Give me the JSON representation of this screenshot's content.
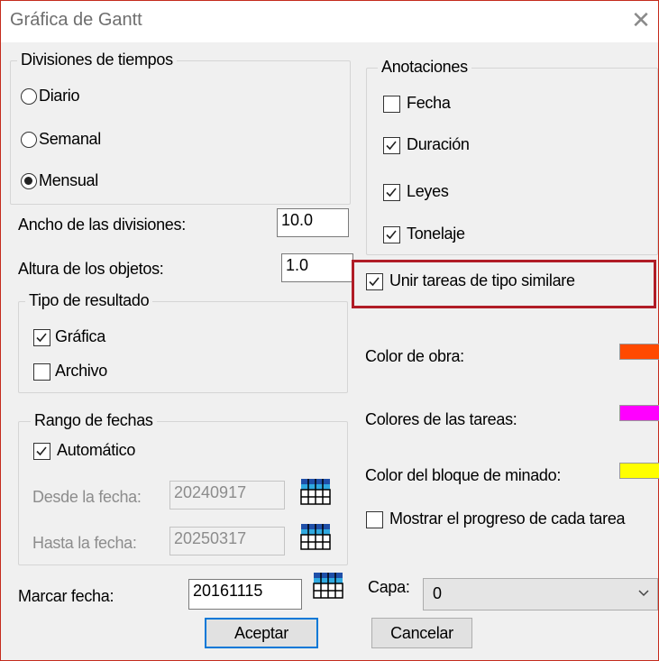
{
  "window": {
    "title": "Gráfica de Gantt",
    "close_glyph": "✕"
  },
  "time_divisions": {
    "legend": "Divisiones de tiempos",
    "options": [
      {
        "label": "Diario",
        "selected": false
      },
      {
        "label": "Semanal",
        "selected": false
      },
      {
        "label": "Mensual",
        "selected": true
      }
    ]
  },
  "division_width": {
    "label": "Ancho de las divisiones:",
    "value": "10.0"
  },
  "object_height": {
    "label": "Altura de los objetos:",
    "value": "1.0"
  },
  "result_type": {
    "legend": "Tipo de resultado",
    "options": [
      {
        "label": "Gráfica",
        "checked": true
      },
      {
        "label": "Archivo",
        "checked": false
      }
    ]
  },
  "date_range": {
    "legend": "Rango de fechas",
    "automatic": {
      "label": "Automático",
      "checked": true
    },
    "from": {
      "label": "Desde la fecha:",
      "value": "20240917"
    },
    "to": {
      "label": "Hasta la fecha:",
      "value": "20250317"
    }
  },
  "mark_date": {
    "label": "Marcar fecha:",
    "value": "20161115"
  },
  "annotations": {
    "legend": "Anotaciones",
    "options": [
      {
        "label": "Fecha",
        "checked": false
      },
      {
        "label": "Duración",
        "checked": true
      },
      {
        "label": "Leyes",
        "checked": true
      },
      {
        "label": "Tonelaje",
        "checked": true
      }
    ]
  },
  "join_tasks": {
    "label": "Unir tareas de tipo similare",
    "checked": true
  },
  "colors": {
    "work": {
      "label": "Color de obra:",
      "color": "#ff4a00"
    },
    "tasks": {
      "label": "Colores de las tareas:",
      "color": "#ff00ff"
    },
    "mining_block": {
      "label": "Color del bloque de minado:",
      "color": "#ffff00"
    }
  },
  "show_progress": {
    "label": "Mostrar el progreso de cada tarea",
    "checked": false
  },
  "layer": {
    "label": "Capa:",
    "value": "0"
  },
  "buttons": {
    "accept": "Aceptar",
    "cancel": "Cancelar"
  },
  "icons": {
    "calendar": "calendar-icon",
    "check": "checkmark-icon",
    "chevron": "chevron-down-icon",
    "close": "close-icon"
  }
}
